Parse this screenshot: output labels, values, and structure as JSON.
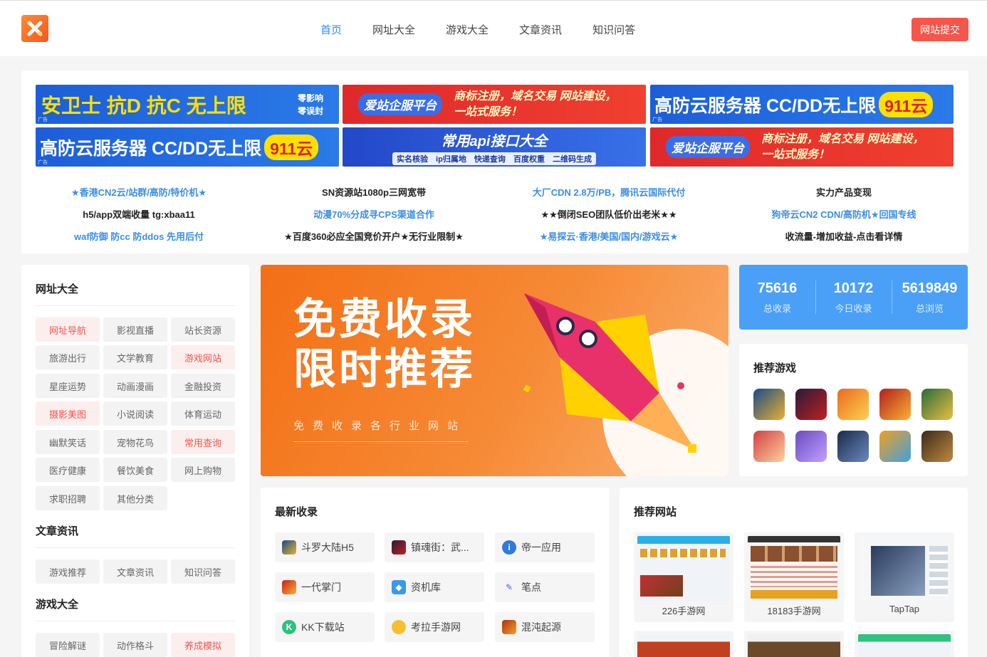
{
  "header": {
    "nav": [
      "首页",
      "网址大全",
      "游戏大全",
      "文章资讯",
      "知识问答"
    ],
    "submit_label": "网站提交"
  },
  "ads": {
    "banners": [
      {
        "text": "安卫士  抗D 抗C 无上限",
        "side": "零影响 零误封",
        "tag": "广告"
      },
      {
        "text": "爱站企服平台",
        "side": "商标注册，域名交易 网站建设，一站式服务！",
        "tag": ""
      },
      {
        "text": "高防云服务器 CC/DD无上限",
        "side": "911云",
        "tag": "广告"
      },
      {
        "text": "高防云服务器 CC/DD无上限",
        "side": "911云",
        "tag": "广告"
      },
      {
        "text": "常用api接口大全",
        "side": "实名核验 ip归属地 快递查询 百度权重 二维码生成",
        "tag": ""
      },
      {
        "text": "爱站企服平台",
        "side": "商标注册，域名交易 网站建设，一站式服务！",
        "tag": ""
      }
    ],
    "text_links": [
      [
        "★香港CN2云/站群/高防/特价机★",
        "SN资源站1080p三网宽带",
        "大厂CDN 2.8万/PB，腾讯云国际代付",
        "实力产品变现"
      ],
      [
        "h5/app双端收量 tg:xbaa11",
        "动漫70%分成寻CPS渠道合作",
        "★★倒闭SEO团队低价出老米★★",
        "狗帝云CN2 CDN/高防机★回国专线"
      ],
      [
        "waf防御 防cc 防ddos 先用后付",
        "★百度360必应全国竞价开户★无行业限制★",
        "★易探云·香港/美国/国内/游戏云★",
        "收流量-增加收益-点击看详情"
      ]
    ]
  },
  "sidebar": {
    "sections": [
      {
        "title": "网址大全",
        "items": [
          "网址导航",
          "影视直播",
          "站长资源",
          "旅游出行",
          "文学教育",
          "游戏网站",
          "星座运势",
          "动画漫画",
          "金融投资",
          "摄影美图",
          "小说阅读",
          "体育运动",
          "幽默笑话",
          "宠物花鸟",
          "常用查询",
          "医疗健康",
          "餐饮美食",
          "网上购物",
          "求职招聘",
          "其他分类"
        ]
      },
      {
        "title": "文章资讯",
        "items": [
          "游戏推荐",
          "文章资讯",
          "知识问答"
        ]
      },
      {
        "title": "游戏大全",
        "items": [
          "冒险解谜",
          "动作格斗",
          "养成模拟"
        ]
      }
    ]
  },
  "hero": {
    "line1": "免费收录",
    "line2": "限时推荐",
    "sub": "免费收录各行业网站"
  },
  "stats": [
    {
      "value": "75616",
      "label": "总收录"
    },
    {
      "value": "10172",
      "label": "今日收录"
    },
    {
      "value": "5619849",
      "label": "总浏览"
    }
  ],
  "games": {
    "title": "推荐游戏"
  },
  "latest": {
    "title": "最新收录",
    "items": [
      "斗罗大陆H5",
      "镇魂街：武...",
      "帝一应用",
      "一代掌门",
      "资机库",
      "笔点",
      "KK下载站",
      "考拉手游网",
      "混沌起源"
    ]
  },
  "recommended": {
    "title": "推荐网站",
    "items": [
      "226手游网",
      "18183手游网",
      "TapTap"
    ]
  },
  "colors": {
    "accent": "#2d8cf0",
    "danger": "#f5554a",
    "stats_bg": "#4aa0f7",
    "hero": "#f36f15"
  }
}
